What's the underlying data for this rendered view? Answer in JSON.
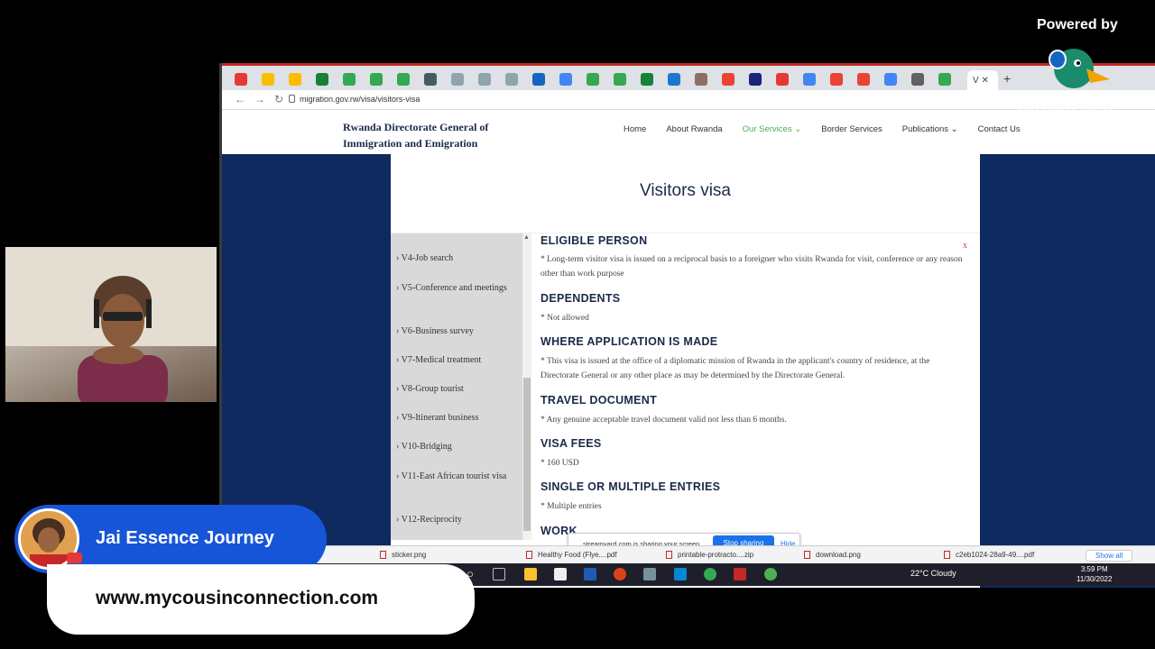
{
  "branding": {
    "powered_by": "Powered by",
    "logo_text": "StreamYard",
    "host_name": "Jai Essence Journey",
    "host_url": "www.mycousinconnection.com"
  },
  "browser": {
    "url": "migration.gov.rw/visa/visitors-visa",
    "active_tab_label": "V"
  },
  "site": {
    "logo": "Rwanda Directorate General of Immigration and Emigration",
    "nav": [
      {
        "label": "Home"
      },
      {
        "label": "About Rwanda"
      },
      {
        "label": "Our Services",
        "active": true
      },
      {
        "label": "Border Services"
      },
      {
        "label": "Publications"
      },
      {
        "label": "Contact Us"
      }
    ],
    "page_title": "Visitors visa"
  },
  "sidebar": {
    "items": [
      {
        "label": "› V4-Job search"
      },
      {
        "label": "› V5-Conference and meetings"
      },
      {
        "label": "› V6-Business survey"
      },
      {
        "label": "› V7-Medical treatment"
      },
      {
        "label": "› V8-Group tourist"
      },
      {
        "label": "› V9-Itinerant business"
      },
      {
        "label": "› V10-Bridging"
      },
      {
        "label": "› V11-East African tourist visa"
      },
      {
        "label": "› V12-Reciprocity"
      }
    ]
  },
  "content": {
    "close_label": "x",
    "sections": [
      {
        "title": "ELIGIBLE PERSON",
        "body": "* Long-term visitor visa is issued on a reciprocal basis to a foreigner who visits Rwanda for visit, conference or any reason other than work purpose"
      },
      {
        "title": "DEPENDENTS",
        "body": "* Not allowed"
      },
      {
        "title": "WHERE APPLICATION IS MADE",
        "body": "* This visa is issued at the office of a diplomatic mission of Rwanda in the applicant's country of residence, at the Directorate General or any other place as may be determined by the Directorate General."
      },
      {
        "title": "TRAVEL DOCUMENT",
        "body": "* Any genuine acceptable travel document valid not less than 6 months."
      },
      {
        "title": "VISA FEES",
        "body": "* 160 USD"
      },
      {
        "title": "SINGLE OR MULTIPLE ENTRIES",
        "body": "* Multiple entries"
      },
      {
        "title": "WORK",
        "body": ""
      }
    ]
  },
  "downloads": {
    "items": [
      {
        "name": "sticker.png"
      },
      {
        "name": "Healthy Food (Flye....pdf"
      },
      {
        "name": "printable-protracto....zip"
      },
      {
        "name": "download.png"
      },
      {
        "name": "c2eb1024-28a9-49....pdf"
      }
    ],
    "show_all": "Show all"
  },
  "share_bar": {
    "message": "streamyard.com is sharing your screen.",
    "stop_label": "Stop sharing",
    "hide_label": "Hide"
  },
  "taskbar": {
    "weather": "22°C  Cloudy",
    "time": "3:59 PM",
    "date": "11/30/2022"
  }
}
